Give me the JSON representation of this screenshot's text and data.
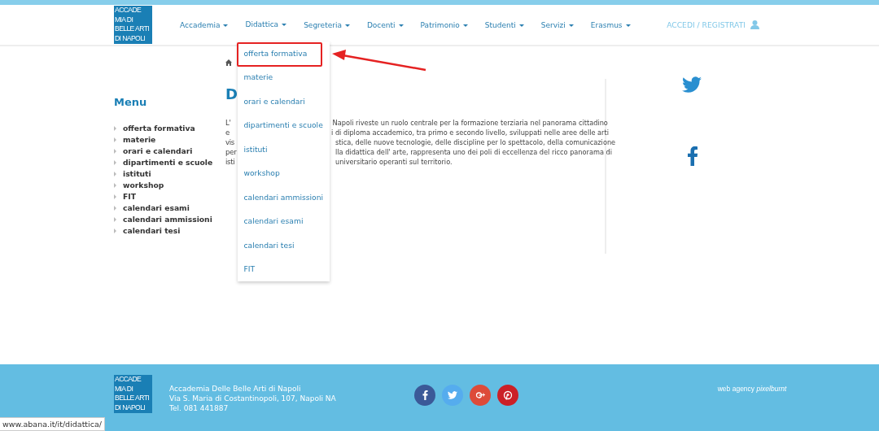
{
  "header": {
    "logo_lines": [
      "ACCADE",
      "MIA DI",
      "BELLE ARTI",
      "DI NAPOLI"
    ],
    "nav_items": [
      {
        "label": "Accademia",
        "selected": false
      },
      {
        "label": "Didattica",
        "selected": true
      },
      {
        "label": "Segreteria",
        "selected": false
      },
      {
        "label": "Docenti",
        "selected": false
      },
      {
        "label": "Patrimonio",
        "selected": false
      },
      {
        "label": "Studenti",
        "selected": false
      },
      {
        "label": "Servizi",
        "selected": false
      },
      {
        "label": "Erasmus",
        "selected": false
      }
    ],
    "account_link": "ACCEDI / REGISTRATI",
    "dropdown": [
      {
        "label": "offerta formativa",
        "highlighted": true
      },
      {
        "label": "materie",
        "highlighted": false
      },
      {
        "label": "orari e calendari",
        "highlighted": false
      },
      {
        "label": "dipartimenti e scuole",
        "highlighted": false
      },
      {
        "label": "istituti",
        "highlighted": false
      },
      {
        "label": "workshop",
        "highlighted": false
      },
      {
        "label": "calendari ammissioni",
        "highlighted": false
      },
      {
        "label": "calendari esami",
        "highlighted": false
      },
      {
        "label": "calendari tesi",
        "highlighted": false
      },
      {
        "label": "FIT",
        "highlighted": false
      }
    ]
  },
  "sidebar": {
    "title": "Menu",
    "items": [
      "offerta formativa",
      "materie",
      "orari e calendari",
      "dipartimenti e scuole",
      "istituti",
      "workshop",
      "FIT",
      "calendari esami",
      "calendari ammissioni",
      "calendari tesi"
    ]
  },
  "content": {
    "heading": "D",
    "paragraph_lines": [
      {
        "left": "L'",
        "right": "Napoli riveste un ruolo centrale per  la formazione terziaria nel panorama cittadino"
      },
      {
        "left": "e",
        "right": "i di diploma accademico, tra primo e secondo livello, sviluppati nelle aree delle arti"
      },
      {
        "left": "vis",
        "right": "stica, delle nuove tecnologie, delle discipline per lo spettacolo, della comunicazione"
      },
      {
        "left": "per",
        "right": "lla didattica dell'  arte, rappresenta uno dei poli di eccellenza del ricco panorama di"
      },
      {
        "left": "isti",
        "right": "universitario operanti sul territorio."
      }
    ]
  },
  "share": [
    {
      "kind": "twitter"
    },
    {
      "kind": "facebook"
    }
  ],
  "footer": {
    "logo_lines": [
      "ACCADE",
      "MIA DI",
      "BELLE ARTI",
      "DI NAPOLI"
    ],
    "address_lines": [
      "Accademia Delle Belle Arti di Napoli",
      "Via S. Maria di Costantinopoli, 107, Napoli NA",
      "Tel. 081 441887"
    ],
    "socials": [
      {
        "kind": "facebook",
        "color": "#3b5998"
      },
      {
        "kind": "twitter",
        "color": "#55acee"
      },
      {
        "kind": "googleplus",
        "color": "#dd4b39"
      },
      {
        "kind": "pinterest",
        "color": "#cb2027"
      }
    ],
    "credit": "web agency *pixelburnt*"
  },
  "status_url": "www.abana.it/it/didattica/"
}
